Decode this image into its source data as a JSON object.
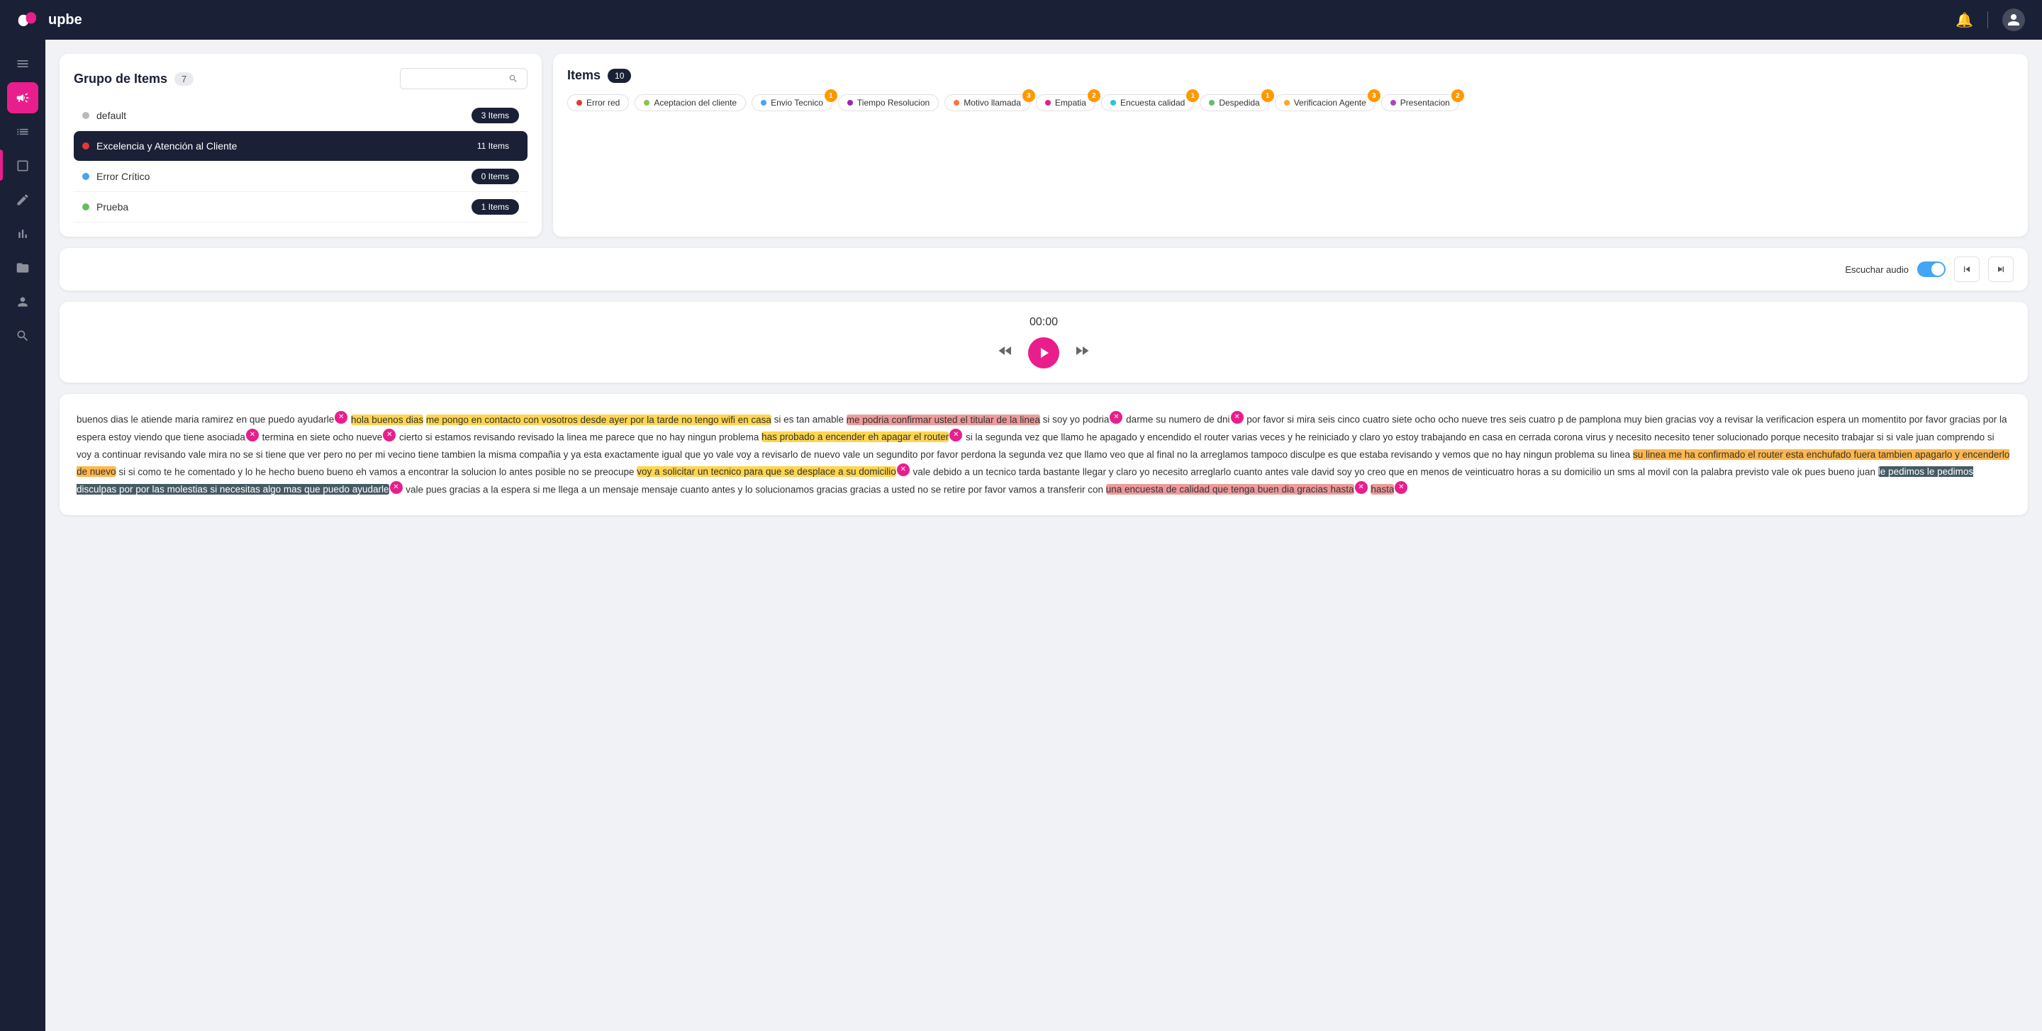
{
  "topnav": {
    "logo_text": "upbe"
  },
  "sidebar": {
    "items": [
      {
        "id": "menu",
        "icon": "☰",
        "active": false
      },
      {
        "id": "megaphone",
        "icon": "📢",
        "active": true
      },
      {
        "id": "list",
        "icon": "☰",
        "active": false
      },
      {
        "id": "square",
        "icon": "⬜",
        "active": false
      },
      {
        "id": "pencil",
        "icon": "✏️",
        "active": false
      },
      {
        "id": "chart",
        "icon": "📊",
        "active": false
      },
      {
        "id": "folder",
        "icon": "📁",
        "active": false
      },
      {
        "id": "person",
        "icon": "👤",
        "active": false
      },
      {
        "id": "search",
        "icon": "🔍",
        "active": false
      }
    ]
  },
  "grupo_panel": {
    "title": "Grupo de Items",
    "count": 7,
    "search_placeholder": "",
    "groups": [
      {
        "name": "default",
        "dot": "gray",
        "badge": "3 Items",
        "selected": false
      },
      {
        "name": "Excelencia y Atención al Cliente",
        "dot": "red",
        "badge": "11 Items",
        "selected": true
      },
      {
        "name": "Error Crítico",
        "dot": "blue",
        "badge": "0 Items",
        "selected": false
      },
      {
        "name": "Prueba",
        "dot": "green",
        "badge": "1 Items",
        "selected": false
      }
    ]
  },
  "items_panel": {
    "title": "Items",
    "count": 10,
    "tags": [
      {
        "label": "Error red",
        "badge": null
      },
      {
        "label": "Aceptacion del cliente",
        "badge": null
      },
      {
        "label": "Envio Tecnico",
        "badge": "1"
      },
      {
        "label": "Tiempo Resolucion",
        "badge": null
      },
      {
        "label": "Motivo llamada",
        "badge": "3"
      },
      {
        "label": "Empatia",
        "badge": "2"
      },
      {
        "label": "Encuesta calidad",
        "badge": "1"
      },
      {
        "label": "Despedida",
        "badge": "1"
      },
      {
        "label": "Verificacion Agente",
        "badge": "3"
      },
      {
        "label": "Presentacion",
        "badge": "2"
      }
    ]
  },
  "audio": {
    "label": "Escuchar audio",
    "enabled": true
  },
  "player": {
    "time": "00:00"
  },
  "transcript": {
    "text": "buenos dias le atiende maria ramirez en que puedo ayudarle hola buenos dias me pongo en contacto con vosotros desde ayer por la tarde no tengo wifi en casa si es tan amable me podria confirmar usted el titular de la linea si soy yo podria darme su numero de dni por favor si mira seis cinco cuatro siete ocho ocho nueve tres seis cuatro p de pamplona muy bien gracias voy a revisar la verificacion espera un momentito por favor gracias por la espera estoy viendo que tiene asociada termina en siete ocho nueve cierto si estamos revisando revisado la linea me parece que no hay ningun problema has probado a encender eh apagar el router si la segunda vez que llamo he apagado y encendido el router varias veces y he reiniciado y claro yo estoy trabajando en casa en cerrada corona virus y necesito necesito tener solucionado porque necesito trabajar si si vale juan comprendo si voy a continuar revisando vale mira no se si tiene que ver pero no per mi vecino tiene tambien la misma compañia y ya esta exactamente igual que yo vale voy a revisarlo de nuevo vale un segundito por favor perdona la segunda vez que llamo veo que al final no la arreglamos tampoco disculpe es que estaba revisando y vemos que no hay ningun problema su linea su linea me ha confirmado el router esta enchufado fuera tambien apagarlo y encenderlo de nuevo si si como te he comentado y lo he hecho bueno bueno eh vamos a encontrar la solucion lo antes posible no se preocupe voy a solicitar un tecnico para que se desplace a su domicilio vale debido a un tecnico tarda bastante llegar y claro yo necesito arreglarlo cuanto antes vale david soy yo creo que en menos de veinticuatro horas a su domicilio un sms al movil con la palabra previsto vale ok pues bueno juan le pedimos le pedimos disculpas por por las molestias si necesitas algo mas que puedo ayudarle vale pues gracias a la espera si me llega a un mensaje mensaje cuanto antes y lo solucionamos gracias gracias a usted no se retire por favor vamos a transferir con una encuesta de calidad que tenga buen dia gracias hasta hasta"
  }
}
